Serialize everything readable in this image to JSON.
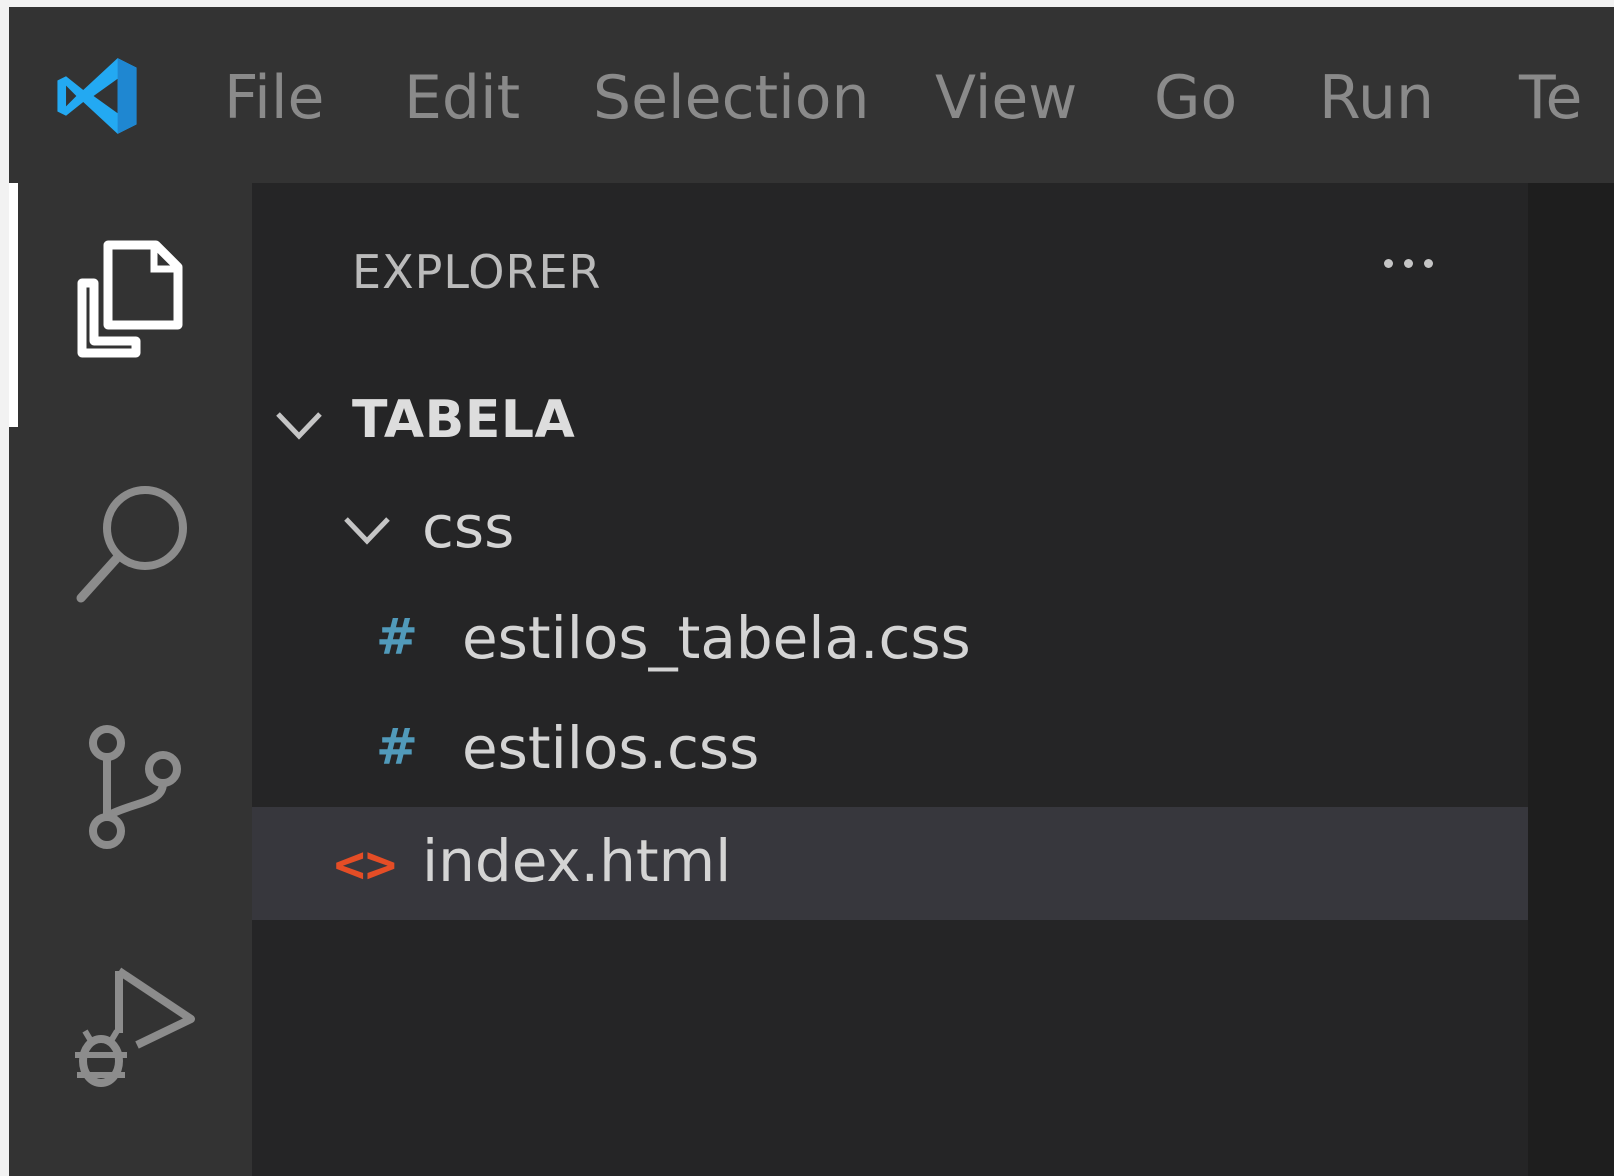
{
  "menu": {
    "file": "File",
    "edit": "Edit",
    "selection": "Selection",
    "view": "View",
    "go": "Go",
    "run": "Run",
    "terminal_partial": "Te"
  },
  "activity_bar": {
    "items": [
      "explorer-icon",
      "search-icon",
      "source-control-icon",
      "run-debug-icon"
    ],
    "active": "explorer-icon"
  },
  "explorer": {
    "title": "EXPLORER",
    "more_actions_icon": "ellipsis-icon",
    "root_folder": "TABELA",
    "subfolder": "css",
    "css_files": [
      "estilos_tabela.css",
      "estilos.css"
    ],
    "html_file": "index.html",
    "selected_file": "index.html",
    "css_file_icon_glyph": "#",
    "html_file_icon_glyph": "<>"
  },
  "colors": {
    "titlebar": "#333333",
    "activitybar": "#333333",
    "sidebar": "#252526",
    "selection": "#37373d",
    "css_icon": "#519aba",
    "html_icon": "#e44d26",
    "logo": "#23a9f2"
  }
}
